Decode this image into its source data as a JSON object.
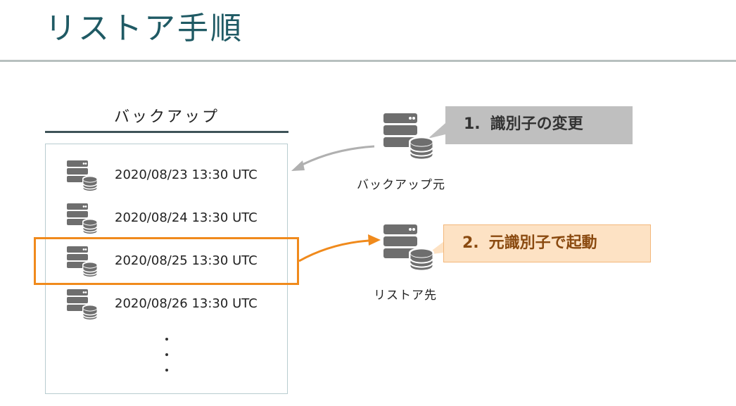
{
  "slide": {
    "title": "リストア手順"
  },
  "backup": {
    "heading": "バックアップ",
    "items": [
      {
        "label": "2020/08/23 13:30 UTC",
        "highlighted": false
      },
      {
        "label": "2020/08/24 13:30 UTC",
        "highlighted": false
      },
      {
        "label": "2020/08/25 13:30 UTC",
        "highlighted": true
      },
      {
        "label": "2020/08/26 13:30 UTC",
        "highlighted": false
      }
    ]
  },
  "nodes": {
    "source": {
      "label": "バックアップ元",
      "icon": "server-database-icon"
    },
    "target": {
      "label": "リストア先",
      "icon": "server-database-icon"
    }
  },
  "steps": [
    {
      "number": "1.",
      "text": "識別子の変更",
      "color": "#bfbfbf"
    },
    {
      "number": "2.",
      "text": "元識別子で起動",
      "color": "#fde2c4"
    }
  ],
  "colors": {
    "highlight": "#f08a1c",
    "title": "#1f5a64",
    "arrow_gray": "#b0b0b0",
    "icon": "#6e6e6e"
  }
}
